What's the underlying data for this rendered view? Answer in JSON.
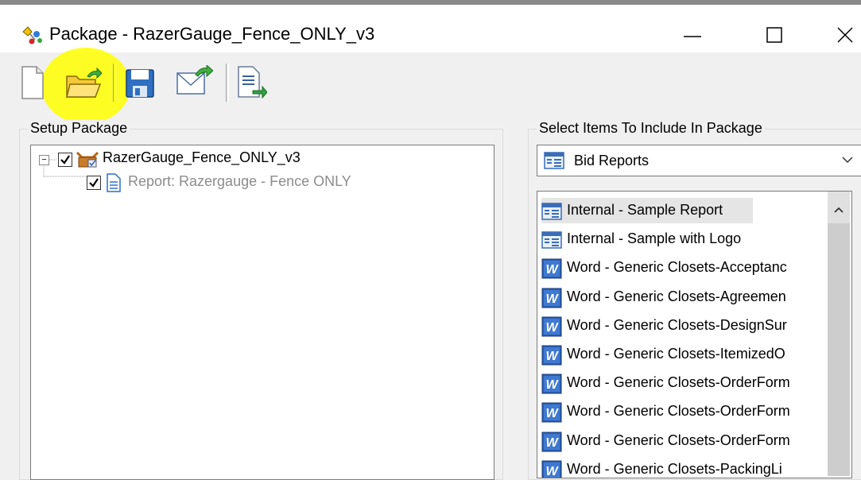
{
  "window": {
    "title": "Package - RazerGauge_Fence_ONLY_v3",
    "controls": [
      "minimize",
      "maximize",
      "close"
    ]
  },
  "toolbar": {
    "buttons": [
      {
        "name": "new-icon"
      },
      {
        "name": "open-folder-icon",
        "highlighted": true
      },
      {
        "name": "save-icon"
      },
      {
        "name": "email-icon"
      },
      {
        "name": "export-icon"
      }
    ],
    "highlight_color": "#ffff00"
  },
  "setup": {
    "label": "Setup Package",
    "tree": [
      {
        "text": "RazerGauge_Fence_ONLY_v3",
        "checked": true,
        "expander": "−",
        "icon": "package-icon"
      },
      {
        "text": "Report: Razergauge - Fence ONLY",
        "checked": true,
        "icon": "report-icon",
        "muted": true
      }
    ]
  },
  "select": {
    "label": "Select Items To Include In Package",
    "dropdown": {
      "value": "Bid Reports"
    },
    "items": [
      {
        "text": "Internal - Sample Report",
        "icon": "report",
        "selected": true
      },
      {
        "text": "Internal - Sample with Logo",
        "icon": "report"
      },
      {
        "text": "Word - Generic Closets-Acceptanc",
        "icon": "word"
      },
      {
        "text": "Word - Generic Closets-Agreemen",
        "icon": "word"
      },
      {
        "text": "Word - Generic Closets-DesignSur",
        "icon": "word"
      },
      {
        "text": "Word - Generic Closets-ItemizedO",
        "icon": "word"
      },
      {
        "text": "Word - Generic Closets-OrderForm",
        "icon": "word"
      },
      {
        "text": "Word - Generic Closets-OrderForm",
        "icon": "word"
      },
      {
        "text": "Word - Generic Closets-OrderForm",
        "icon": "word"
      },
      {
        "text": "Word - Generic Closets-PackingLi",
        "icon": "word"
      }
    ]
  }
}
